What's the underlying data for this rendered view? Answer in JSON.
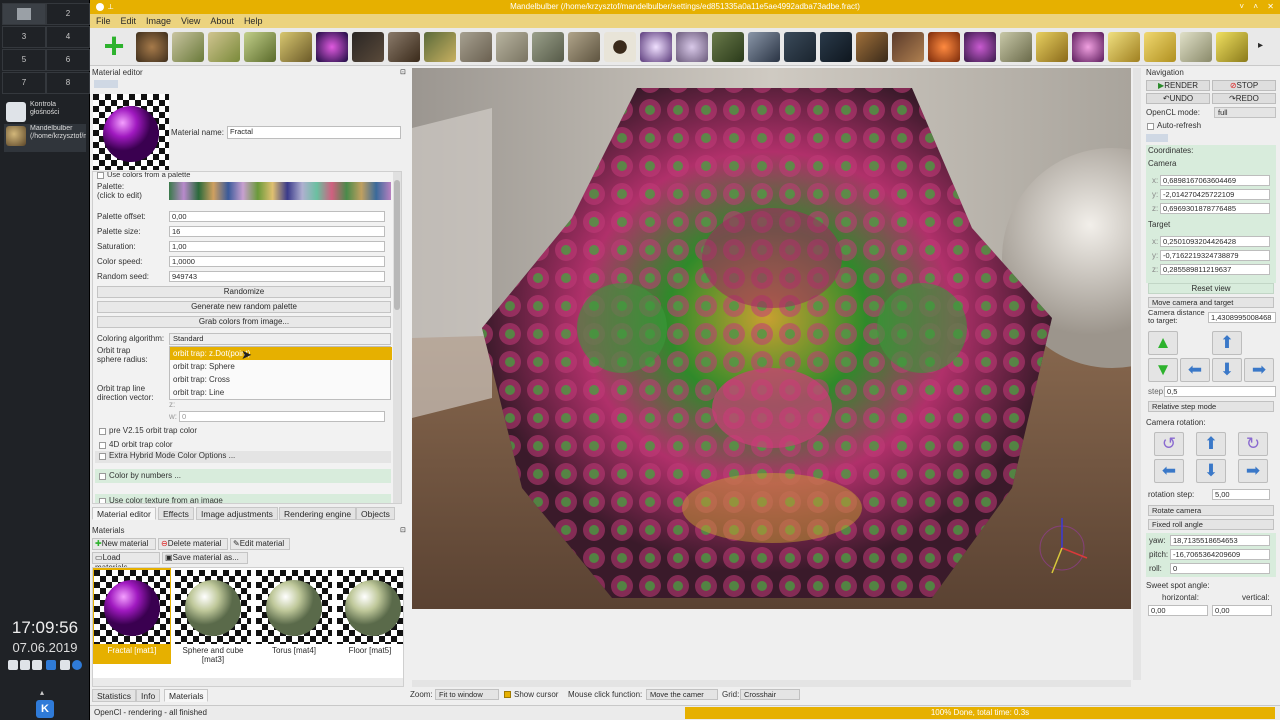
{
  "desktop": {
    "workspaces": [
      "",
      "2",
      "3",
      "4",
      "5",
      "6",
      "7",
      "8"
    ],
    "tasks": [
      {
        "label": "Kontrola głośności",
        "icon": "speaker-icon"
      },
      {
        "label": "Mandelbulber (/home/krzysztof/mandelbulber/s...",
        "icon": "mandelbulber-icon"
      }
    ],
    "clock": "17:09:56",
    "date": "07.06.2019"
  },
  "window": {
    "title": "Mandelbulber (/home/krzysztof/mandelbulber/settings/ed851335a0a11e5ae4992adba73adbe.fract)",
    "menu": [
      "File",
      "Edit",
      "Image",
      "View",
      "About",
      "Help"
    ]
  },
  "material_editor": {
    "dock_title": "Material editor",
    "material_name_label": "Material name:",
    "material_name_value": "Fractal",
    "use_colors_label": "Use colors from a palette",
    "palette_label": "Palette:\n(click to edit)",
    "rows": [
      {
        "label": "Palette offset:",
        "value": "0,00"
      },
      {
        "label": "Palette size:",
        "value": "16"
      },
      {
        "label": "Saturation:",
        "value": "1,00"
      },
      {
        "label": "Color speed:",
        "value": "1,0000"
      },
      {
        "label": "Random seed:",
        "value": "949743"
      }
    ],
    "buttons": [
      "Randomize",
      "Generate new random palette",
      "Grab colors from image..."
    ],
    "coloring_algorithm_label": "Coloring algorithm:",
    "coloring_algorithm_value": "Standard",
    "orbit_trap_radius_label": "Orbit trap\nsphere radius:",
    "orbit_trap_line_label": "Orbit trap line\ndirection vector:",
    "dropdown_options": [
      "orbit trap: z.Dot(point)",
      "orbit trap: Sphere",
      "orbit trap: Cross",
      "orbit trap: Line"
    ],
    "vector_z": "z:",
    "vector_w": "w:",
    "vector_w_value": "0",
    "checks": [
      "pre V2.15 orbit trap color",
      "4D orbit trap color",
      "Extra Hybrid Mode Color Options ...",
      "Color by numbers ...",
      "Use color texture from an image"
    ]
  },
  "left_tabs": [
    "Material editor",
    "Effects",
    "Image adjustments",
    "Rendering engine",
    "Objects"
  ],
  "materials": {
    "dock_title": "Materials",
    "buttons": [
      "New material",
      "Delete material",
      "Edit material",
      "Load materials...",
      "Save material as..."
    ],
    "items": [
      {
        "label": "Fractal [mat1]",
        "selected": true
      },
      {
        "label": "Sphere and cube\n[mat3]",
        "selected": false
      },
      {
        "label": "Torus [mat4]",
        "selected": false
      },
      {
        "label": "Floor [mat5]",
        "selected": false
      }
    ]
  },
  "bottom_tabs": [
    "Statistics",
    "Info",
    "Materials"
  ],
  "status": {
    "message": "OpenCl - rendering - all finished",
    "progress_text": "100% Done, total time: 0.3s",
    "progress": 1.0
  },
  "view_controls": {
    "zoom_label": "Zoom:",
    "zoom_value": "Fit to window",
    "show_cursor_label": "Show cursor",
    "mouse_click_label": "Mouse click function:",
    "mouse_click_value": "Move the camer",
    "grid_label": "Grid:",
    "grid_value": "Crosshair"
  },
  "navigation": {
    "dock_title": "Navigation",
    "render_label": "RENDER",
    "stop_label": "STOP",
    "undo_label": "UNDO",
    "redo_label": "REDO",
    "opencl_mode_label": "OpenCL mode:",
    "opencl_mode_value": "full",
    "auto_refresh_label": "Auto-refresh",
    "coordinates_label": "Coordinates:",
    "camera_label": "Camera",
    "camera": {
      "x": "0,6898167063604469",
      "y": "-2,014270425722109",
      "z": "0,6969301878776485"
    },
    "target_label": "Target",
    "target": {
      "x": "0,2501093204426428",
      "y": "-0,7162219324738879",
      "z": "0,285589811219637"
    },
    "reset_view_label": "Reset view",
    "camera_mode": "Move camera and target",
    "distance_label": "Camera distance\nto target:",
    "distance_value": "1,4308995008468",
    "step_label": "step:",
    "step_value": "0,5",
    "step_mode": "Relative step mode",
    "rotation_label": "Camera rotation:",
    "rotation_step_label": "rotation step:",
    "rotation_step_value": "5,00",
    "rotate_mode": "Rotate camera",
    "roll_mode": "Fixed roll angle",
    "yaw_label": "yaw:",
    "yaw_value": "18,7135518654653",
    "pitch_label": "pitch:",
    "pitch_value": "-16,7065364209609",
    "roll_label": "roll:",
    "roll_value": "0",
    "sweet_spot_label": "Sweet spot angle:",
    "horizontal_label": "horizontal:",
    "horizontal_value": "0,00",
    "vertical_label": "vertical:",
    "vertical_value": "0,00"
  },
  "colors": {
    "accent": "#e6b000",
    "panel_green": "#d8ecdc"
  }
}
